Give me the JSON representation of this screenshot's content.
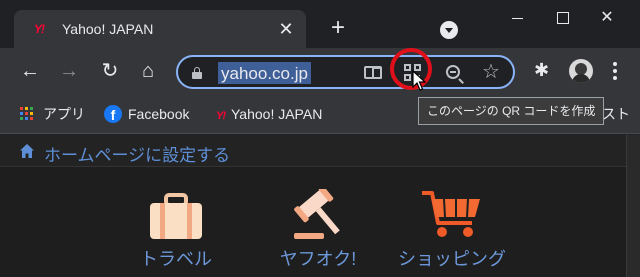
{
  "tab": {
    "favicon": "Y!",
    "title": "Yahoo! JAPAN",
    "close": "✕"
  },
  "tabstrip": {
    "new_tab": "+"
  },
  "window": {
    "close": "✕"
  },
  "toolbar": {
    "back": "←",
    "forward": "→",
    "reload": "↻",
    "home": "⌂",
    "url": "yahoo.co.jp",
    "bookmark_star": "☆",
    "extensions": "✱"
  },
  "bookmarks": {
    "apps": "アプリ",
    "facebook": "Facebook",
    "facebook_glyph": "f",
    "yahoo_glyph": "Y!",
    "yahoo": "Yahoo! JAPAN",
    "overflow": "スト"
  },
  "tooltip": "このページの QR コードを作成",
  "page": {
    "set_homepage": "ホームページに設定する",
    "services": [
      "トラベル",
      "ヤフオク!",
      "ショッピング"
    ]
  },
  "colors": {
    "accent": "#8ab4f8",
    "highlight_ring": "#e0101a",
    "link": "#6c98d9",
    "url_selection": "#3f5f99"
  }
}
